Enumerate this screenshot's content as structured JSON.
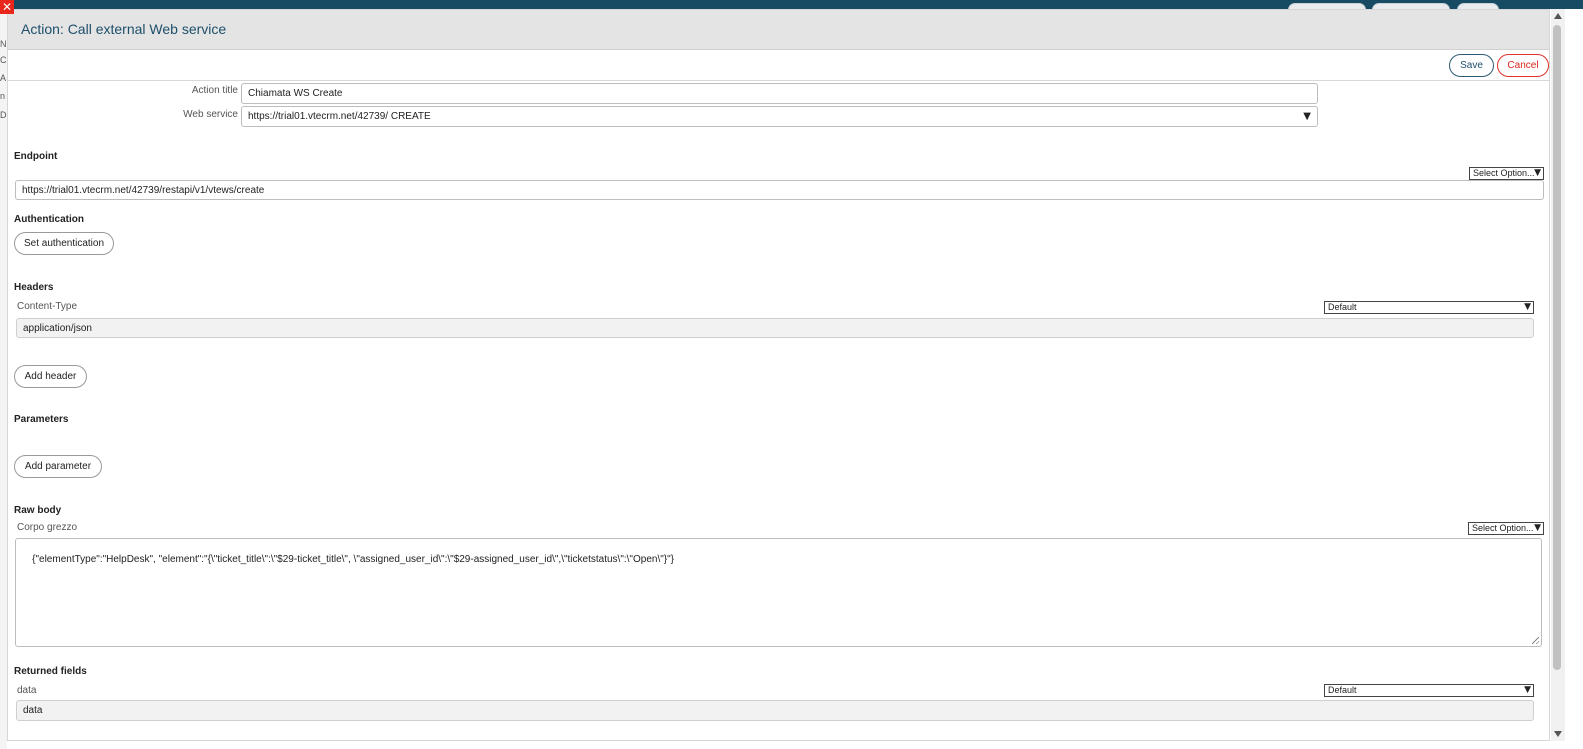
{
  "background_app": {
    "left_letters": [
      "N",
      "C",
      "A",
      "n",
      "D"
    ]
  },
  "dialog": {
    "title": "Action: Call external Web service",
    "save_label": "Save",
    "cancel_label": "Cancel",
    "close_icon": "close-icon"
  },
  "form": {
    "action_title_label": "Action title",
    "action_title_value": "Chiamata WS Create",
    "web_service_label": "Web service",
    "web_service_value": "https://trial01.vtecrm.net/42739/ CREATE"
  },
  "endpoint": {
    "title": "Endpoint",
    "select_option": "Select Option...",
    "url": "https://trial01.vtecrm.net/42739/restapi/v1/vtews/create"
  },
  "authentication": {
    "title": "Authentication",
    "button": "Set authentication"
  },
  "headers": {
    "title": "Headers",
    "items": [
      {
        "name": "Content-Type",
        "mode": "Default",
        "value": "application/json"
      }
    ],
    "add_button": "Add header"
  },
  "parameters": {
    "title": "Parameters",
    "add_button": "Add parameter"
  },
  "raw_body": {
    "title": "Raw body",
    "sub_label": "Corpo grezzo",
    "select_option": "Select Option...",
    "value": "{\"elementType\":\"HelpDesk\", \"element\":\"{\\\"ticket_title\\\":\\\"$29-ticket_title\\\", \\\"assigned_user_id\\\":\\\"$29-assigned_user_id\\\",\\\"ticketstatus\\\":\\\"Open\\\"}\"}"
  },
  "returned_fields": {
    "title": "Returned fields",
    "items": [
      {
        "name": "data",
        "mode": "Default",
        "value": "data"
      }
    ]
  }
}
